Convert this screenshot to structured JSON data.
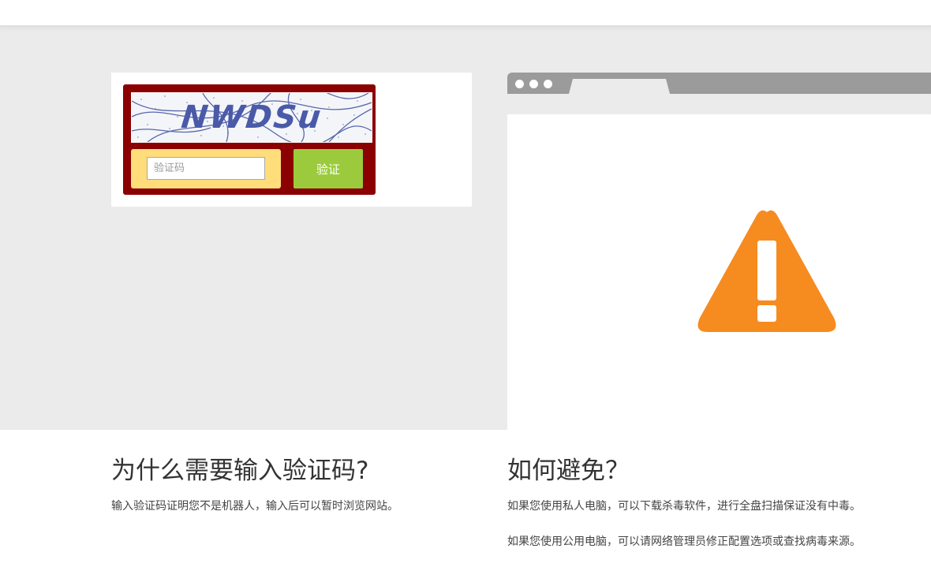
{
  "captcha": {
    "image_text": "NWDSu",
    "input_placeholder": "验证码",
    "input_value": "",
    "verify_label": "验证",
    "colors": {
      "frame": "#8b0000",
      "input_area": "#ffdd7a",
      "button": "#9bcb3c"
    }
  },
  "browser_mock": {
    "icon": "warning-icon",
    "icon_color": "#f68b1f"
  },
  "why": {
    "title": "为什么需要输入验证码?",
    "text": "输入验证码证明您不是机器人，输入后可以暂时浏览网站。"
  },
  "avoid": {
    "title": "如何避免？",
    "paragraphs": [
      "如果您使用私人电脑，可以下载杀毒软件，进行全盘扫描保证没有中毒。",
      "如果您使用公用电脑，可以请网络管理员修正配置选项或查找病毒来源。"
    ]
  }
}
